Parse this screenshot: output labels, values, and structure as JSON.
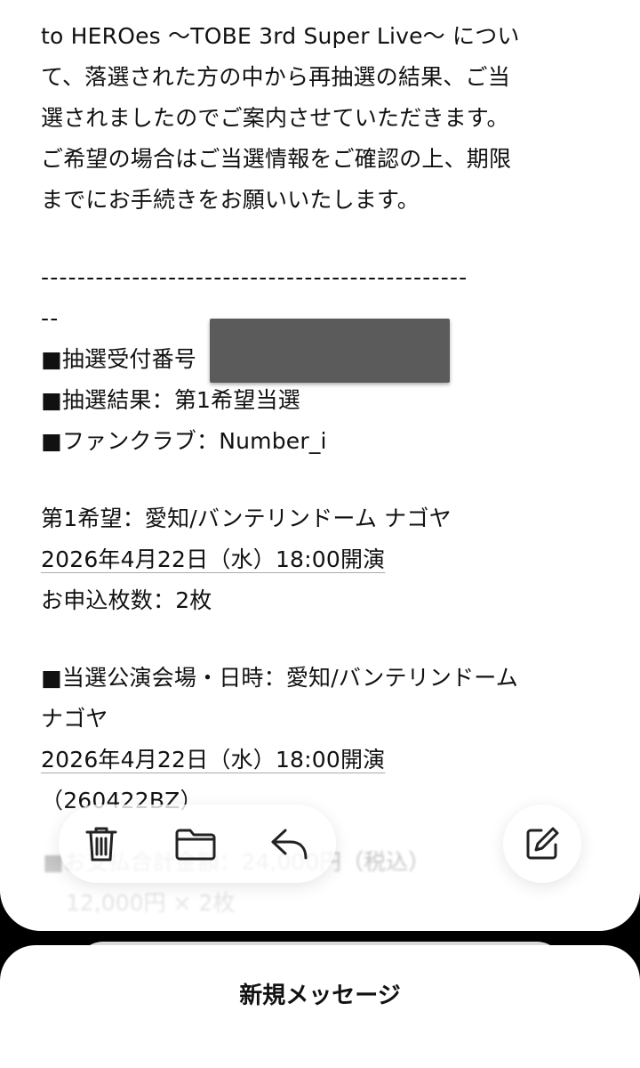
{
  "mail": {
    "intro": [
      "to HEROes 〜TOBE 3rd Super Live〜 につい",
      "て、落選された方の中から再抽選の結果、ご当",
      "選されましたのでご案内させていただきます。",
      "ご希望の場合はご当選情報をご確認の上、期限",
      "までにお手続きをお願いいたします。"
    ],
    "divider_line1": "-----------------------------------------------",
    "divider_line2": "--",
    "entry_number_label": "■抽選受付番号",
    "result_line": "■抽選結果：第1希望当選",
    "fanclub_line": "■ファンクラブ：Number_i",
    "first_choice_line": "第1希望：愛知/バンテリンドーム ナゴヤ",
    "first_choice_date": "2026年4月22日（水）18:00開演",
    "ticket_count_line": "お申込枚数：2枚",
    "venue_line1": "■当選公演会場・日時：愛知/バンテリンドーム",
    "venue_line2": "ナゴヤ",
    "venue_date": "2026年4月22日（水）18:00開演",
    "performance_code": "（260422BZ）",
    "total_line_partial": "■お支払合計金額：24,000円（税込）",
    "price_detail_partial": "12,000円 × 2枚"
  },
  "toolbar": {
    "icons": [
      "trash-icon",
      "folder-icon",
      "reply-icon"
    ],
    "compose_icon": "compose-icon"
  },
  "new_message": {
    "title": "新規メッセージ"
  }
}
